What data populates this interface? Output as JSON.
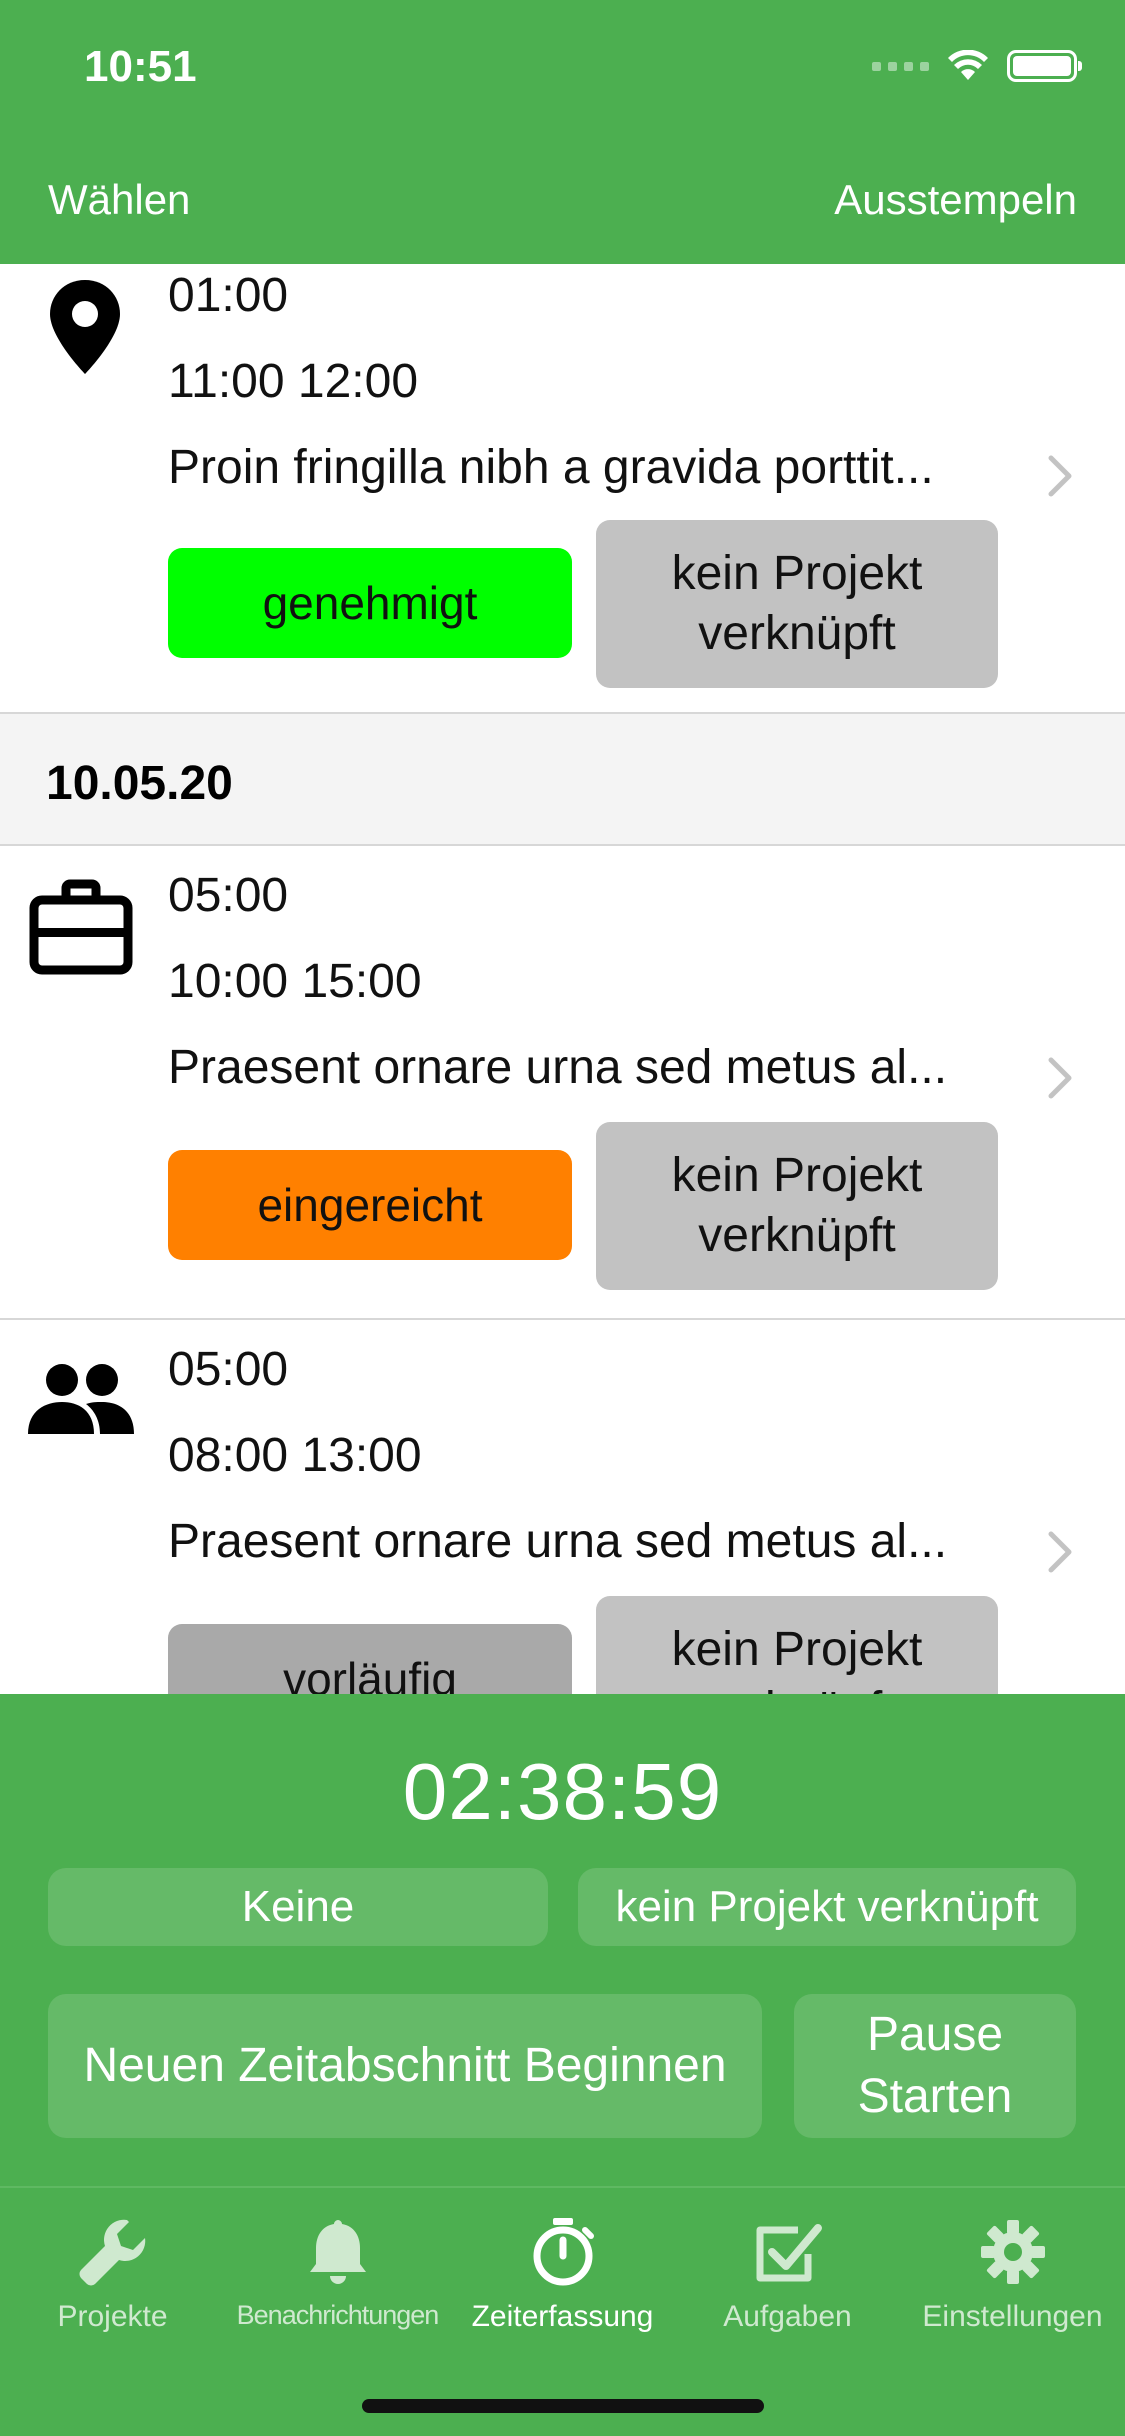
{
  "status_bar": {
    "time": "10:51"
  },
  "nav": {
    "left": "Wählen",
    "right": "Ausstempeln"
  },
  "entries_top": [
    {
      "icon": "location-pin-icon",
      "duration": "01:00",
      "range": "11:00 12:00",
      "description": "Proin fringilla nibh a gravida porttit...",
      "status": "genehmigt",
      "status_color": "#00ff00",
      "project": "kein Projekt verknüpft"
    }
  ],
  "section": {
    "date": "10.05.20"
  },
  "entries": [
    {
      "icon": "briefcase-icon",
      "duration": "05:00",
      "range": "10:00 15:00",
      "description": "Praesent ornare urna sed metus al...",
      "status": "eingereicht",
      "status_color": "#ff8000",
      "project": "kein Projekt verknüpft"
    },
    {
      "icon": "people-icon",
      "duration": "05:00",
      "range": "08:00 13:00",
      "description": "Praesent ornare urna sed metus al...",
      "status": "vorläufig",
      "status_color": "#a9a9a9",
      "project": "kein Projekt verknüpft"
    }
  ],
  "timer": {
    "elapsed": "02:38:59",
    "category": "Keine",
    "project": "kein Projekt verknüpft",
    "new_segment": "Neuen Zeitabschnitt Beginnen",
    "pause": "Pause Starten"
  },
  "tabs": [
    {
      "label": "Projekte",
      "icon": "wrench-icon"
    },
    {
      "label": "Benachrichtungen",
      "icon": "bell-icon"
    },
    {
      "label": "Zeiterfassung",
      "icon": "stopwatch-icon",
      "active": true
    },
    {
      "label": "Aufgaben",
      "icon": "checkbox-icon"
    },
    {
      "label": "Einstellungen",
      "icon": "gear-icon"
    }
  ],
  "colors": {
    "primary": "#4caf50",
    "project_button": "#c2c2c2"
  }
}
